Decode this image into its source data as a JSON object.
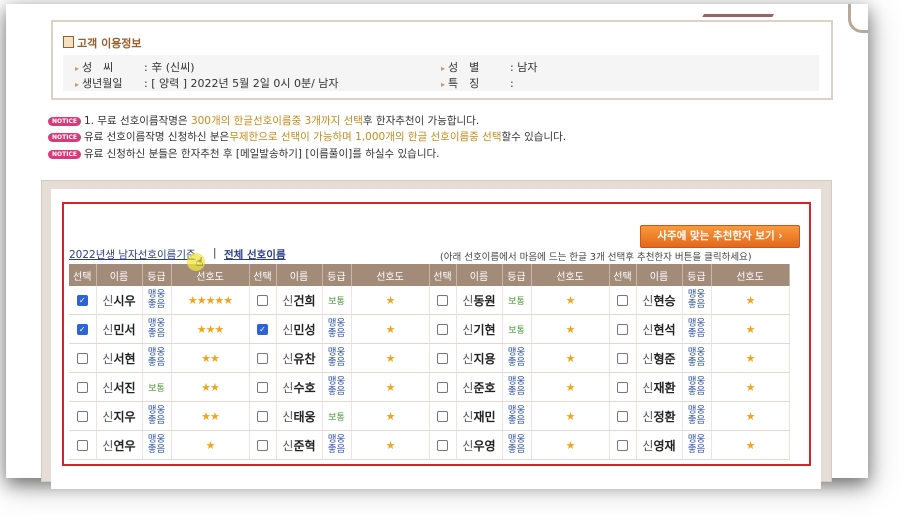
{
  "info": {
    "title": "고객 이용정보",
    "surname_label": "성　씨",
    "surname_value": ": 辛 (신씨)",
    "birth_label": "생년월일",
    "birth_value": ": [ 양력 ] 2022년 5월 2일 0시 0분/ 남자",
    "gender_label": "성　별",
    "gender_value": ": 남자",
    "special_label": "특　징",
    "special_value": ":"
  },
  "notices": {
    "badge": "NOTICE",
    "n1_a": "1. 무료 선호이름작명은 ",
    "n1_b": "300개의 한글선호이름중 3개까지 선택",
    "n1_c": "후 한자추천이 가능합니다.",
    "n2_a": "유료 선호이름작명 신청하신 분은",
    "n2_b": "무제한으로 선택이 가능하며 1,000개의 한글 선호이름중 선택",
    "n2_c": "할수 있습니다.",
    "n3": "유료 신청하신 분들은 한자추천 후 [메일발송하기] [이름풀이]를 하실수 있습니다."
  },
  "recommend_button": "사주에 맞는 추천한자 보기  ›",
  "tabs": {
    "year_tab": "2022년생 남자선호이름기준",
    "sep": "|",
    "all_tab": "전체 선호이름"
  },
  "hint": "(아래 선호이름에서 마음에 드는 한글 3개 선택후 추천한자 버튼을 클릭하세요)",
  "table": {
    "headers": [
      "선택",
      "이름",
      "등급",
      "선호도"
    ],
    "grades": {
      "nice": "맹웅\n좋음",
      "norm": "보통"
    },
    "rows": [
      [
        {
          "checked": true,
          "surname": "신",
          "given": "시우",
          "grade": "맹웅좋음",
          "stars": "★★★★★"
        },
        {
          "checked": false,
          "surname": "신",
          "given": "건희",
          "grade": "보통",
          "stars": "★"
        },
        {
          "checked": false,
          "surname": "신",
          "given": "동원",
          "grade": "보통",
          "stars": "★"
        },
        {
          "checked": false,
          "surname": "신",
          "given": "현승",
          "grade": "맹웅좋음",
          "stars": "★"
        }
      ],
      [
        {
          "checked": true,
          "surname": "신",
          "given": "민서",
          "grade": "맹웅좋음",
          "stars": "★★★"
        },
        {
          "checked": true,
          "surname": "신",
          "given": "민성",
          "grade": "맹웅좋음",
          "stars": "★"
        },
        {
          "checked": false,
          "surname": "신",
          "given": "기현",
          "grade": "보통",
          "stars": "★"
        },
        {
          "checked": false,
          "surname": "신",
          "given": "현석",
          "grade": "맹웅좋음",
          "stars": "★"
        }
      ],
      [
        {
          "checked": false,
          "surname": "신",
          "given": "서현",
          "grade": "맹웅좋음",
          "stars": "★★"
        },
        {
          "checked": false,
          "surname": "신",
          "given": "유찬",
          "grade": "맹웅좋음",
          "stars": "★"
        },
        {
          "checked": false,
          "surname": "신",
          "given": "지용",
          "grade": "맹웅좋음",
          "stars": "★"
        },
        {
          "checked": false,
          "surname": "신",
          "given": "형준",
          "grade": "맹웅좋음",
          "stars": "★"
        }
      ],
      [
        {
          "checked": false,
          "surname": "신",
          "given": "서진",
          "grade": "보통",
          "stars": "★★"
        },
        {
          "checked": false,
          "surname": "신",
          "given": "수호",
          "grade": "맹웅좋음",
          "stars": "★"
        },
        {
          "checked": false,
          "surname": "신",
          "given": "준호",
          "grade": "맹웅좋음",
          "stars": "★"
        },
        {
          "checked": false,
          "surname": "신",
          "given": "재환",
          "grade": "맹웅좋음",
          "stars": "★"
        }
      ],
      [
        {
          "checked": false,
          "surname": "신",
          "given": "지우",
          "grade": "맹웅좋음",
          "stars": "★★"
        },
        {
          "checked": false,
          "surname": "신",
          "given": "태웅",
          "grade": "보통",
          "stars": "★"
        },
        {
          "checked": false,
          "surname": "신",
          "given": "재민",
          "grade": "맹웅좋음",
          "stars": "★"
        },
        {
          "checked": false,
          "surname": "신",
          "given": "정환",
          "grade": "맹웅좋음",
          "stars": "★"
        }
      ],
      [
        {
          "checked": false,
          "surname": "신",
          "given": "연우",
          "grade": "맹웅좋음",
          "stars": "★"
        },
        {
          "checked": false,
          "surname": "신",
          "given": "준혁",
          "grade": "맹웅좋음",
          "stars": "★"
        },
        {
          "checked": false,
          "surname": "신",
          "given": "우영",
          "grade": "맹웅좋음",
          "stars": "★"
        },
        {
          "checked": false,
          "surname": "신",
          "given": "영재",
          "grade": "맹웅좋음",
          "stars": "★"
        }
      ]
    ]
  },
  "colors": {
    "accent": "#d6232a",
    "header": "#a38b79",
    "button": "#f08a2c",
    "star": "#f1a51c"
  }
}
